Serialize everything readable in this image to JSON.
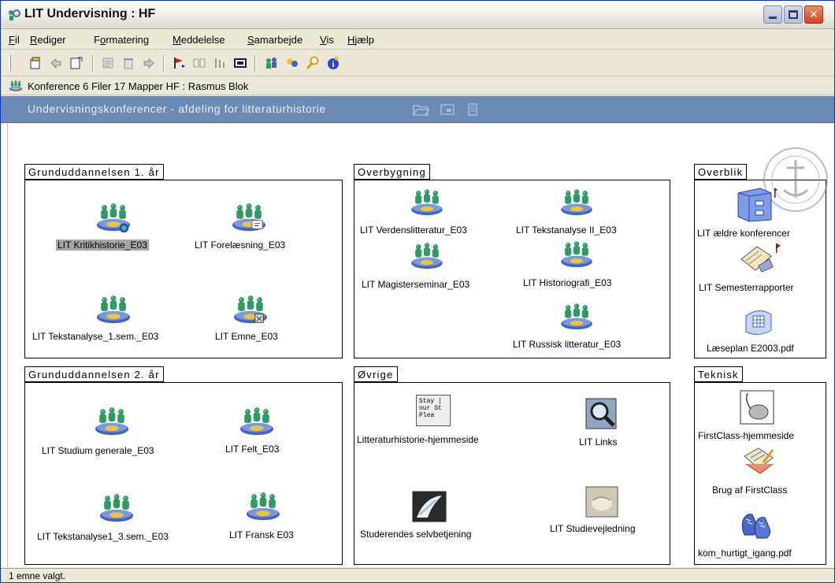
{
  "window": {
    "title": "LIT Undervisning : HF"
  },
  "menu": [
    {
      "pre": "",
      "ul": "F",
      "post": "il"
    },
    {
      "pre": "",
      "ul": "R",
      "post": "ediger"
    },
    {
      "pre": "F",
      "ul": "o",
      "post": "rmatering"
    },
    {
      "pre": "",
      "ul": "M",
      "post": "eddelelse"
    },
    {
      "pre": "",
      "ul": "S",
      "post": "amarbejde"
    },
    {
      "pre": "",
      "ul": "V",
      "post": "is"
    },
    {
      "pre": "",
      "ul": "H",
      "post": "jælp"
    }
  ],
  "infobar": {
    "text": "Konference  6 Filer 17 Mapper  HF : Rasmus Blok"
  },
  "banner": {
    "text": "Undervisningskonferencer - afdeling for litteraturhistorie"
  },
  "panels": {
    "grund1": {
      "label": "Grunduddannelsen 1. år",
      "items": [
        "LIT Kritikhistorie_E03",
        "LIT Forelæsning_E03",
        "LIT Tekstanalyse_1.sem._E03",
        "LIT Emne_E03"
      ]
    },
    "overbygning": {
      "label": "Overbygning",
      "items": [
        "LIT Verdenslitteratur_E03",
        "LIT Tekstanalyse II_E03",
        "LIT Magisterseminar_E03",
        "LIT Historiografi_E03",
        "LIT Russisk litteratur_E03"
      ]
    },
    "overblik": {
      "label": "Overblik",
      "items": [
        "LIT ældre konferencer",
        "LIT Semesterrapporter",
        "Læseplan E2003.pdf"
      ]
    },
    "grund2": {
      "label": "Grunduddannelsen 2. år",
      "items": [
        "LIT Studium generale_E03",
        "LIT Felt_E03",
        "LIT Tekstanalyse1_3.sem._E03",
        "LIT Fransk E03"
      ]
    },
    "ovrige": {
      "label": "Øvrige",
      "items": [
        "Litteraturhistorie-hjemmeside",
        "LIT Links",
        "Studerendes selvbetjening",
        "LIT Studievejledning"
      ],
      "note_text": "Stay | our St Plea"
    },
    "teknisk": {
      "label": "Teknisk",
      "items": [
        "FirstClass-hjemmeside",
        "Brug af FirstClass",
        "kom_hurtigt_igang.pdf"
      ]
    }
  },
  "status": {
    "text": "1 emne valgt."
  },
  "colors": {
    "banner": "#6c8bb4",
    "people_green": "#3aa86a",
    "disc_blue": "#3f63c9",
    "chrome": "#ece9d8"
  }
}
